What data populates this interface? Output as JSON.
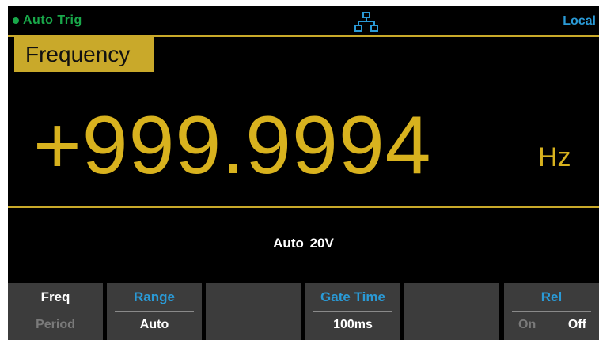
{
  "status": {
    "trigger": "Auto Trig",
    "mode": "Local",
    "icons": {
      "trigger": "status-dot-icon",
      "network": "lan-network-icon"
    }
  },
  "measurement": {
    "function": "Frequency",
    "value": "+999.9994",
    "unit": "Hz",
    "range_info": "Auto 20V"
  },
  "softkeys": [
    {
      "top": "Freq",
      "bottom": "Period"
    },
    {
      "top": "Range",
      "bottom": "Auto"
    },
    {
      "top": "",
      "bottom": ""
    },
    {
      "top": "Gate Time",
      "bottom": "100ms"
    },
    {
      "top": "",
      "bottom": ""
    },
    {
      "top": "Rel",
      "on": "On",
      "off": "Off"
    }
  ],
  "colors": {
    "background": "#000000",
    "accent_yellow": "#c9a92a",
    "reading_yellow": "#d8b21e",
    "trig_green": "#19a84a",
    "status_blue": "#2a9ad6",
    "softkey_gray": "#3c3c3c"
  }
}
